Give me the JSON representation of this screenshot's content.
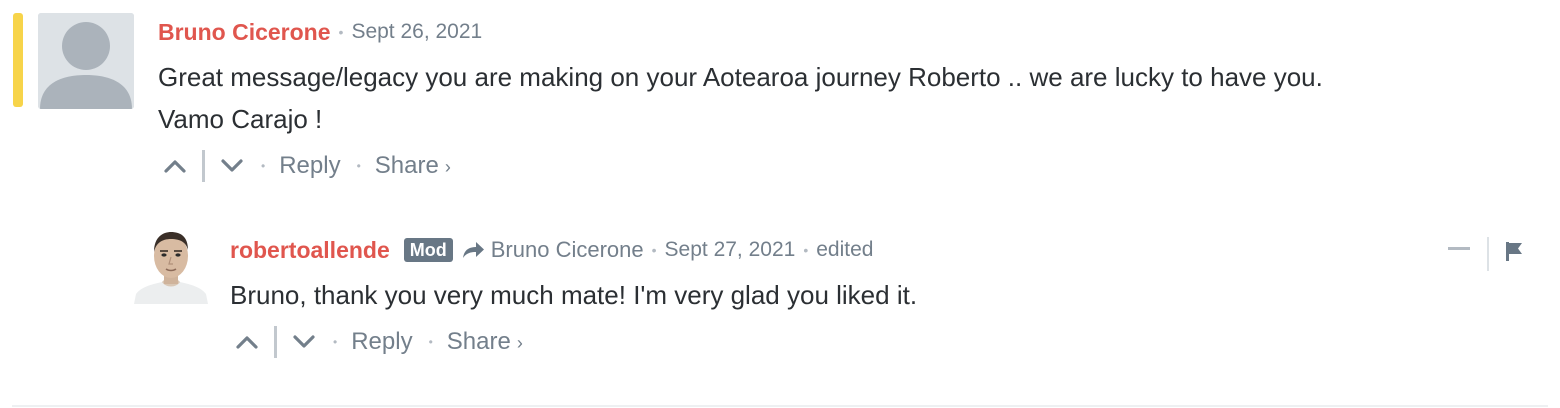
{
  "comments": [
    {
      "author": "Bruno Cicerone",
      "date": "Sept 26, 2021",
      "message_lines": [
        "Great message/legacy you are making on your Aotearoa journey Roberto .. we are lucky to have you.",
        "Vamo Carajo !"
      ],
      "avatar_icon": "default-user-avatar",
      "highlight_color": "#f7d44a",
      "actions": {
        "reply_label": "Reply",
        "share_label": "Share",
        "share_arrow": "›"
      }
    },
    {
      "author": "robertoallende",
      "badge": "Mod",
      "reply_to": "Bruno Cicerone",
      "date": "Sept 27, 2021",
      "edited_label": "edited",
      "message_lines": [
        "Bruno, thank you very much mate! I'm very glad you liked it."
      ],
      "avatar_icon": "user-photo-avatar",
      "actions": {
        "reply_label": "Reply",
        "share_label": "Share",
        "share_arrow": "›"
      }
    }
  ],
  "colors": {
    "author": "#e0564e",
    "meta_text": "#737f8b",
    "body_text": "#2b2f33",
    "mod_badge": "#687785",
    "highlight": "#f7d44a"
  },
  "separator_dot": "•"
}
